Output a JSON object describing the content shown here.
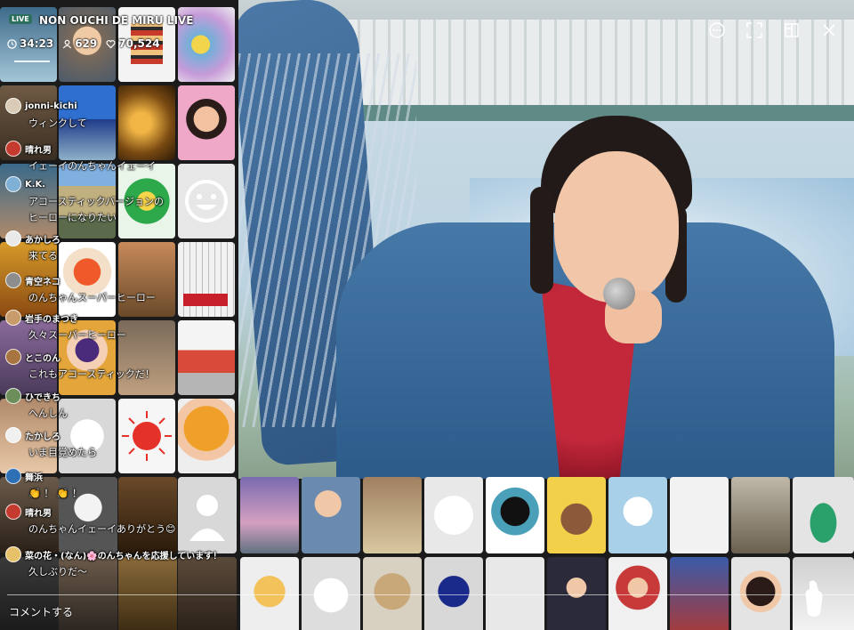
{
  "header": {
    "live_badge": "LIVE",
    "title": "NON OUCHI DE MIRU LIVE",
    "elapsed": "34:23",
    "viewers": "629",
    "likes": "70,524"
  },
  "controls": {
    "icons": [
      "comment-bubble-icon",
      "fullscreen-icon",
      "layout-icon",
      "close-icon"
    ]
  },
  "comments": [
    {
      "name": "jonni-kichi",
      "text": "ウィンクして",
      "avatar_color": "#d9cbb5"
    },
    {
      "name": "晴れ男",
      "text": "イェーイのんちゃんイェーイ",
      "avatar_color": "#c43a2e"
    },
    {
      "name": "K.K.",
      "text": "アコースティックバージョンの",
      "text2": "ヒーローになりたい",
      "avatar_color": "#7fb0d6"
    },
    {
      "name": "あかしろ",
      "text": "来てる",
      "avatar_color": "#e9e9e9"
    },
    {
      "name": "青空ネコ",
      "text": "のんちゃんスーパーヒーロー",
      "avatar_color": "#8d8d8d"
    },
    {
      "name": "岩手のまつき",
      "text": "久々スーパーヒーロー",
      "avatar_color": "#c79b6a"
    },
    {
      "name": "とこのん",
      "text": "これもアコースティックだ！",
      "avatar_color": "#a8743f"
    },
    {
      "name": "ひできち",
      "text": "へんしん",
      "avatar_color": "#6b8e5a"
    },
    {
      "name": "たかしろ",
      "text": "いま目覚めたら",
      "avatar_color": "#f0f0f0"
    },
    {
      "name": "舞浜",
      "text": "👏 ！ 👏 ！",
      "avatar_color": "#2f6fb3"
    },
    {
      "name": "晴れ男",
      "text": "のんちゃんイェーイありがとう😊",
      "avatar_color": "#c43a2e"
    },
    {
      "name": "菜の花・(なん)🌸のんちゃんを応援しています！",
      "text": "久しぶりだ〜",
      "avatar_color": "#e7c16a"
    }
  ],
  "comment_input": {
    "placeholder": "コメントする"
  },
  "colors": {
    "overlay_text": "#ffffff",
    "live_badge_bg": "#2c6f5e",
    "background": "#1b1b1b"
  }
}
